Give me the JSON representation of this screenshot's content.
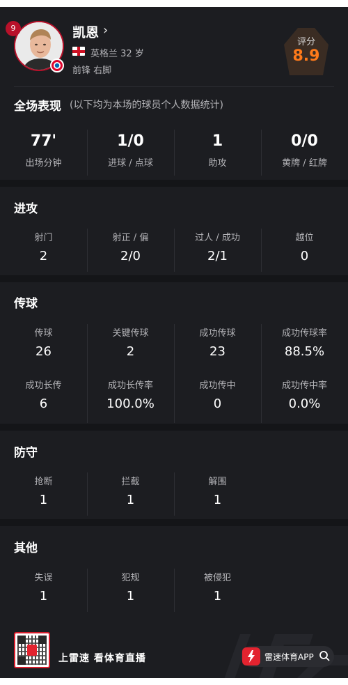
{
  "player": {
    "name": "凯恩",
    "name_chevron": "›",
    "number": "9",
    "nation": "英格兰  32 岁",
    "position": "前锋  右脚"
  },
  "rating": {
    "label": "评分",
    "value": "8.9"
  },
  "overview": {
    "title": "全场表现",
    "note": "(以下均为本场的球员个人数据统计)",
    "stats": [
      {
        "value": "77'",
        "label": "出场分钟"
      },
      {
        "value": "1/0",
        "label": "进球 / 点球"
      },
      {
        "value": "1",
        "label": "助攻"
      },
      {
        "value": "0/0",
        "label": "黄牌 / 红牌"
      }
    ]
  },
  "attack": {
    "title": "进攻",
    "stats": [
      {
        "label": "射门",
        "value": "2"
      },
      {
        "label": "射正 / 偏",
        "value": "2/0"
      },
      {
        "label": "过人 / 成功",
        "value": "2/1"
      },
      {
        "label": "越位",
        "value": "0"
      }
    ]
  },
  "passing": {
    "title": "传球",
    "row1": [
      {
        "label": "传球",
        "value": "26"
      },
      {
        "label": "关键传球",
        "value": "2"
      },
      {
        "label": "成功传球",
        "value": "23"
      },
      {
        "label": "成功传球率",
        "value": "88.5%"
      }
    ],
    "row2": [
      {
        "label": "成功长传",
        "value": "6"
      },
      {
        "label": "成功长传率",
        "value": "100.0%"
      },
      {
        "label": "成功传中",
        "value": "0"
      },
      {
        "label": "成功传中率",
        "value": "0.0%"
      }
    ]
  },
  "defense": {
    "title": "防守",
    "stats": [
      {
        "label": "抢断",
        "value": "1"
      },
      {
        "label": "拦截",
        "value": "1"
      },
      {
        "label": "解围",
        "value": "1"
      }
    ]
  },
  "other": {
    "title": "其他",
    "stats": [
      {
        "label": "失误",
        "value": "1"
      },
      {
        "label": "犯规",
        "value": "1"
      },
      {
        "label": "被侵犯",
        "value": "1"
      }
    ]
  },
  "footer": {
    "slogan": "上雷速  看体育直播",
    "app_label": "雷速体育APP"
  },
  "colors": {
    "background": "#1c1d21",
    "band": "#141518",
    "rating_accent": "#ff7a1a",
    "brand_red": "#e3232f"
  },
  "icons": [
    "player-photo",
    "club-badge-icon",
    "england-flag-icon",
    "chevron-right-icon",
    "qr-code",
    "app-logo-icon",
    "search-icon"
  ]
}
